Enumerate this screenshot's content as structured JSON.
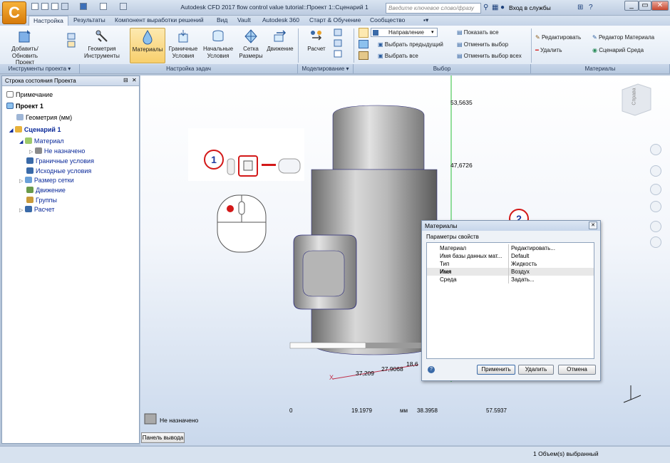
{
  "app": {
    "logo": "C",
    "title": "Autodesk CFD 2017  flow control value tutorial::Проект 1::Сценарий 1",
    "search_placeholder": "Введите ключевое слово/фразу",
    "signin": "Вход в службы"
  },
  "tabs": [
    "Настройка",
    "Результаты",
    "Компонент выработки решений",
    "Вид",
    "Vault",
    "Autodesk 360",
    "Старт & Обучение",
    "Сообщество"
  ],
  "ribbon": {
    "add": "Добавить/Обновить Проект",
    "geometry": "Геометрия Инструменты",
    "materials": "Материалы",
    "boundary": "Граничные Условия",
    "initial": "Начальные Условия",
    "mesh": "Сетка Размеры",
    "motion": "Движение",
    "calc": "Расчет",
    "direction": "Направление",
    "select_prev": "Выбрать предыдущий",
    "select_all": "Выбрать все",
    "show_all": "Показать все",
    "cancel_sel": "Отменить выбор",
    "cancel_all": "Отменить выбор всех",
    "edit": "Редактировать",
    "delete": "Удалить",
    "mat_editor": "Редактор Материала",
    "env_scenario": "Сценарий Среда",
    "groups": {
      "project_tools": "Инструменты проекта",
      "task_setup": "Настройка задач",
      "modeling": "Моделирование",
      "selection": "Выбор",
      "materials": "Материалы"
    }
  },
  "panel": {
    "title": "Строка состояния Проекта",
    "items": [
      "Примечание",
      "Проект 1",
      "Геометрия (мм)",
      "Сценарий 1",
      "Материал",
      "Не назначено",
      "Граничные условия",
      "Исходные условия",
      "Размер сетки",
      "Движение",
      "Группы",
      "Расчет"
    ]
  },
  "viewport": {
    "dims": [
      "53,5635",
      "47,6726",
      "37,209",
      "27,9068",
      "18,6"
    ],
    "scale_ticks": [
      "0",
      "19.1979",
      "38.3958",
      "57.5937"
    ],
    "scale_unit": "мм",
    "legend_label": "Не назначено",
    "viewcube_label": "Справа",
    "callouts": [
      "1",
      "2"
    ]
  },
  "dialog": {
    "title": "Материалы",
    "section": "Параметры свойств",
    "rows": [
      [
        "Материал",
        "Редактировать..."
      ],
      [
        "Имя базы данных мат...",
        "Default"
      ],
      [
        "Тип",
        "Жидкость"
      ],
      [
        "Имя",
        "Воздух"
      ],
      [
        "Среда",
        "Задать..."
      ]
    ],
    "apply": "Применить",
    "delete": "Удалить",
    "cancel": "Отмена"
  },
  "output_panel": "Панель вывода",
  "status": "1 Объем(s) выбранный",
  "colors": {
    "accent": "#f8cf6c",
    "callout": "#d31818",
    "axis": "#2bbf3a"
  }
}
